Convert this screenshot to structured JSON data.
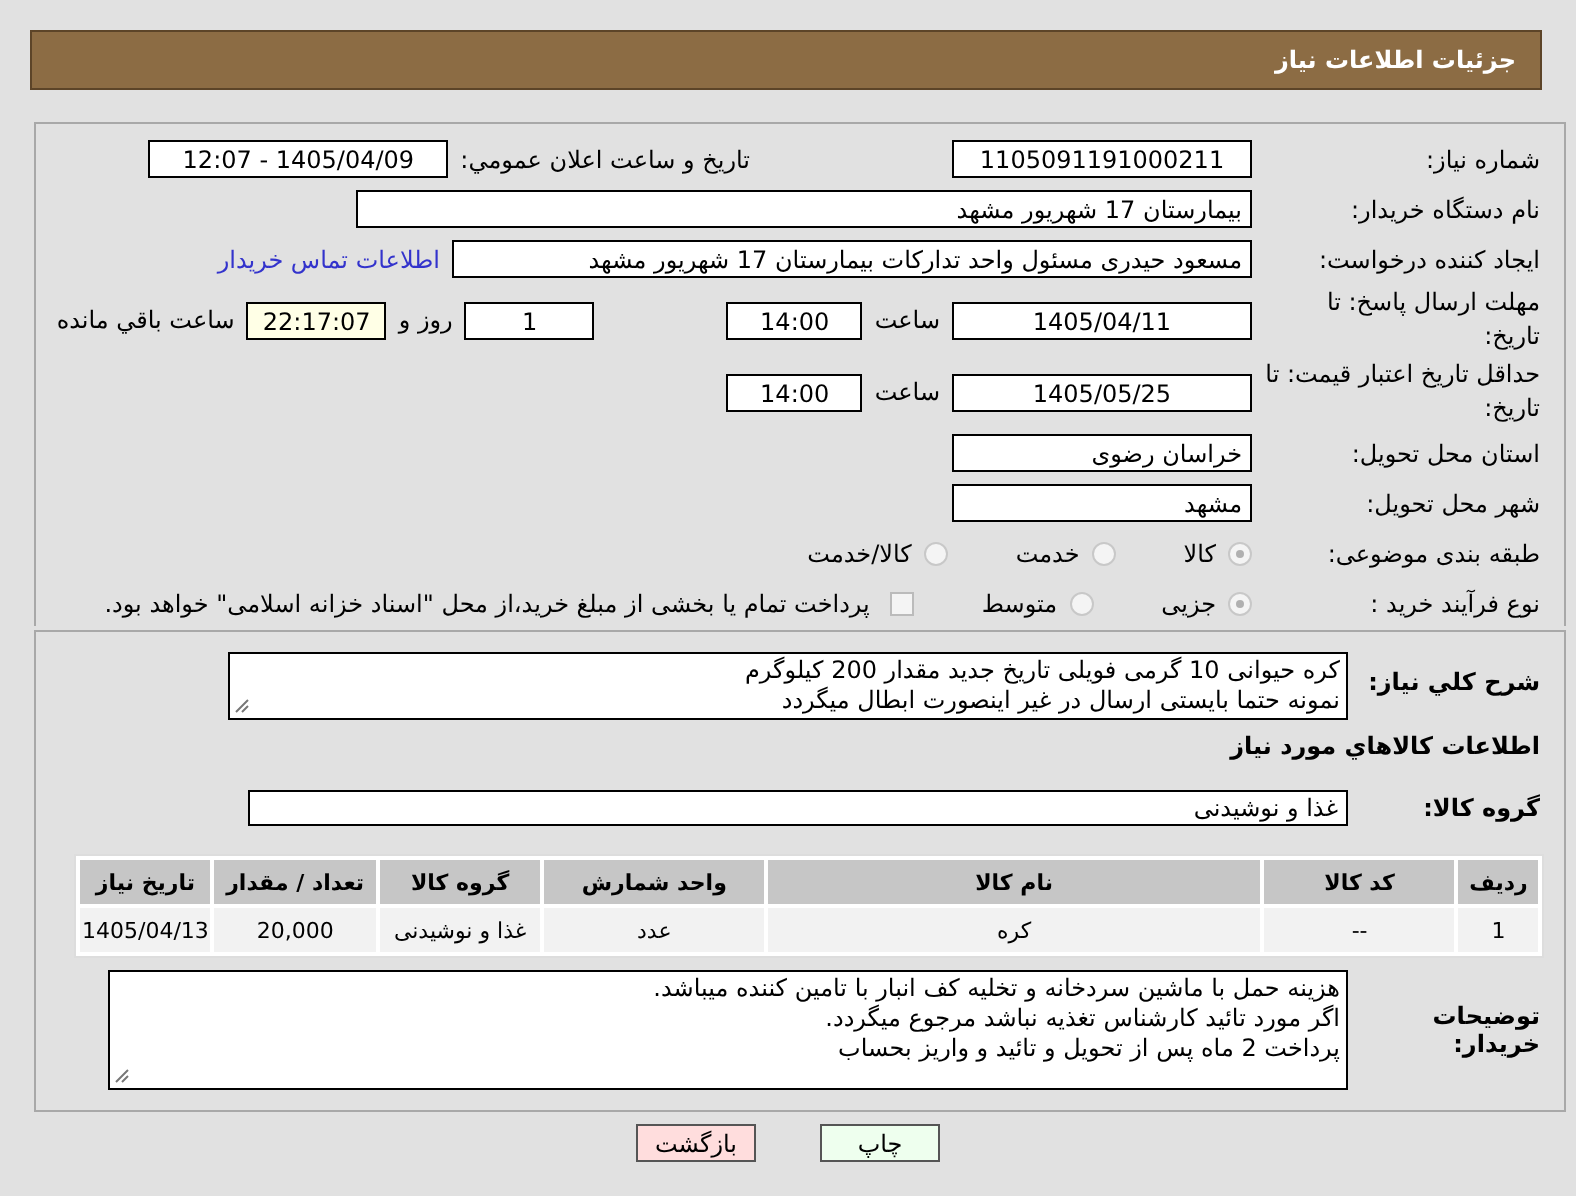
{
  "header": {
    "title": "جزئیات اطلاعات نیاز"
  },
  "need_number": {
    "label": "شماره نیاز:",
    "value": "1105091191000211"
  },
  "announce": {
    "label": "تاریخ و ساعت اعلان عمومي:",
    "value": "1405/04/09 - 12:07"
  },
  "buyer_org": {
    "label": "نام دستگاه خریدار:",
    "value": "بیمارستان 17 شهریور مشهد"
  },
  "creator": {
    "label": "ایجاد کننده درخواست:",
    "value": "مسعود حیدری مسئول واحد تدارکات  بیمارستان 17 شهریور مشهد",
    "link": "اطلاعات تماس خریدار"
  },
  "deadline": {
    "label": "مهلت ارسال پاسخ: تا تاریخ:",
    "date": "1405/04/11",
    "time_label": "ساعت",
    "time": "14:00",
    "days": "1",
    "days_label": "روز و",
    "remaining": "22:17:07",
    "remaining_label": "ساعت باقي مانده"
  },
  "validity": {
    "label": "حداقل تاریخ اعتبار قیمت: تا تاریخ:",
    "date": "1405/05/25",
    "time_label": "ساعت",
    "time": "14:00"
  },
  "province": {
    "label": "استان محل تحویل:",
    "value": "خراسان رضوی"
  },
  "city": {
    "label": "شهر محل تحویل:",
    "value": "مشهد"
  },
  "category": {
    "label": "طبقه بندی موضوعی:",
    "options": [
      {
        "label": "کالا",
        "selected": true
      },
      {
        "label": "خدمت",
        "selected": false
      },
      {
        "label": "کالا/خدمت",
        "selected": false
      }
    ]
  },
  "process": {
    "label": "نوع فرآیند خرید :",
    "options": [
      {
        "label": "جزیی",
        "selected": true
      },
      {
        "label": "متوسط",
        "selected": false
      }
    ],
    "payment": {
      "label": "پرداخت تمام یا بخشی از مبلغ خرید،از محل \"اسناد خزانه اسلامی\" خواهد بود.",
      "checked": false
    }
  },
  "description": {
    "label": "شرح کلي نیاز:",
    "lines": [
      "کره حیوانی 10 گرمی فویلی تاریخ جدید مقدار 200 کیلوگرم",
      "نمونه حتما بایستی ارسال در غیر اینصورت ابطال میگردد"
    ]
  },
  "goods_title": "اطلاعات کالاهاي مورد نیاز",
  "goods_group": {
    "label": "گروه کالا:",
    "value": "غذا و نوشیدنی"
  },
  "table": {
    "columns": [
      "ردیف",
      "کد کالا",
      "نام کالا",
      "واحد شمارش",
      "گروه کالا",
      "تعداد / مقدار",
      "تاریخ نیاز"
    ],
    "rows": [
      [
        "1",
        "--",
        "کره",
        "عدد",
        "غذا و نوشیدنی",
        "20,000",
        "1405/04/13"
      ]
    ]
  },
  "buyer_notes": {
    "label": "توضیحات خریدار:",
    "lines": [
      "هزینه حمل با ماشین سردخانه و تخلیه کف انبار با تامین کننده میباشد.",
      "اگر مورد تائید کارشناس تغذیه نباشد مرجوع میگردد.",
      "پرداخت 2 ماه پس از تحویل و تائید و واریز بحساب"
    ]
  },
  "buttons": [
    {
      "label": "چاپ",
      "kind": "print"
    },
    {
      "label": "بازگشت",
      "kind": "back"
    }
  ]
}
